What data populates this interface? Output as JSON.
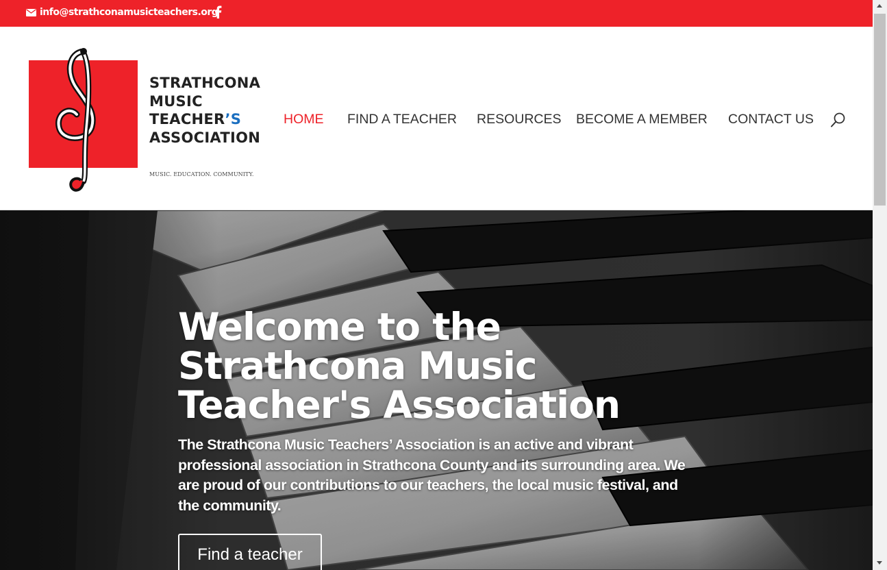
{
  "colors": {
    "brand_red": "#ee2229",
    "nav_text": "#333333",
    "accent_blue": "#1b6fc0"
  },
  "topbar": {
    "email": "info@strathconamusicteachers.org",
    "icons": [
      "envelope-icon",
      "facebook-icon"
    ]
  },
  "logo": {
    "name_lines": [
      "STRATHCONA",
      "MUSIC",
      "TEACHER",
      "ASSOCIATION"
    ],
    "apostrophe_s": "’S",
    "tagline": "MUSIC. EDUCATION. COMMUNITY."
  },
  "nav": {
    "items": [
      {
        "label": "HOME",
        "active": true
      },
      {
        "label": "FIND A TEACHER",
        "active": false
      },
      {
        "label": "RESOURCES",
        "active": false
      },
      {
        "label": "BECOME A MEMBER",
        "active": false
      },
      {
        "label": "CONTACT US",
        "active": false
      }
    ],
    "search_icon": "search-icon"
  },
  "hero": {
    "title": "Welcome to the Strathcona Music Teacher's Association",
    "intro": "The Strathcona Music Teachers’ Association is an active and vibrant professional association in Strathcona County and its surrounding area. We are proud of our contributions to our teachers, the local music festival, and the community.",
    "cta_label": "Find a teacher"
  }
}
